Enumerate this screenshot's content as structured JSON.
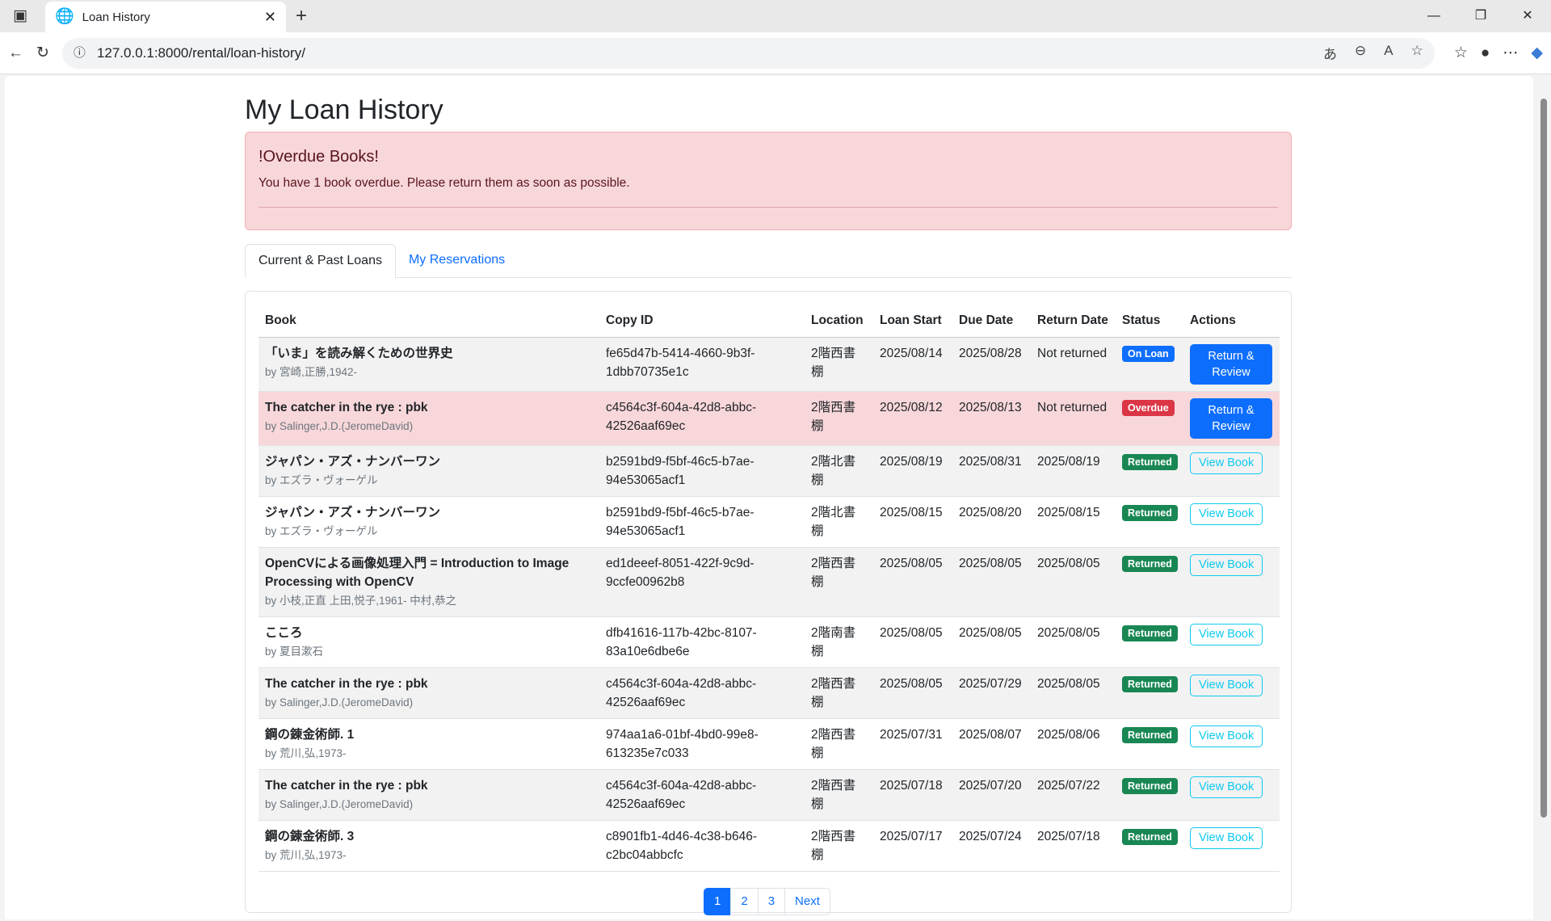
{
  "browser": {
    "tab_title": "Loan History",
    "url": "127.0.0.1:8000/rental/loan-history/"
  },
  "page": {
    "title": "My Loan History"
  },
  "alert": {
    "heading": "!Overdue Books!",
    "message": "You have 1 book overdue. Please return them as soon as possible."
  },
  "tabs": [
    {
      "label": "Current & Past Loans"
    },
    {
      "label": "My Reservations"
    }
  ],
  "table": {
    "headers": [
      "Book",
      "Copy ID",
      "Location",
      "Loan Start",
      "Due Date",
      "Return Date",
      "Status",
      "Actions"
    ],
    "rows": [
      {
        "title": "「いま」を読み解くための世界史",
        "author": "by 宮崎,正勝,1942-",
        "copy_id": "fe65d47b-5414-4660-9b3f-1dbb70735e1c",
        "location": "2階西書棚",
        "loan_start": "2025/08/14",
        "due": "2025/08/28",
        "returned": "Not returned",
        "status": "On Loan",
        "action": "Return & Review"
      },
      {
        "title": "The catcher in the rye : pbk",
        "author": "by Salinger,J.D.(JeromeDavid)",
        "copy_id": "c4564c3f-604a-42d8-abbc-42526aaf69ec",
        "location": "2階西書棚",
        "loan_start": "2025/08/12",
        "due": "2025/08/13",
        "returned": "Not returned",
        "status": "Overdue",
        "action": "Return & Review"
      },
      {
        "title": "ジャパン・アズ・ナンバーワン",
        "author": "by エズラ・ヴォーゲル",
        "copy_id": "b2591bd9-f5bf-46c5-b7ae-94e53065acf1",
        "location": "2階北書棚",
        "loan_start": "2025/08/19",
        "due": "2025/08/31",
        "returned": "2025/08/19",
        "status": "Returned",
        "action": "View Book"
      },
      {
        "title": "ジャパン・アズ・ナンバーワン",
        "author": "by エズラ・ヴォーゲル",
        "copy_id": "b2591bd9-f5bf-46c5-b7ae-94e53065acf1",
        "location": "2階北書棚",
        "loan_start": "2025/08/15",
        "due": "2025/08/20",
        "returned": "2025/08/15",
        "status": "Returned",
        "action": "View Book"
      },
      {
        "title": "OpenCVによる画像処理入門 = Introduction to Image Processing with OpenCV",
        "author": "by 小枝,正直 上田,悦子,1961- 中村,恭之",
        "copy_id": "ed1deeef-8051-422f-9c9d-9ccfe00962b8",
        "location": "2階西書棚",
        "loan_start": "2025/08/05",
        "due": "2025/08/05",
        "returned": "2025/08/05",
        "status": "Returned",
        "action": "View Book"
      },
      {
        "title": "こころ",
        "author": "by 夏目漱石",
        "copy_id": "dfb41616-117b-42bc-8107-83a10e6dbe6e",
        "location": "2階南書棚",
        "loan_start": "2025/08/05",
        "due": "2025/08/05",
        "returned": "2025/08/05",
        "status": "Returned",
        "action": "View Book"
      },
      {
        "title": "The catcher in the rye : pbk",
        "author": "by Salinger,J.D.(JeromeDavid)",
        "copy_id": "c4564c3f-604a-42d8-abbc-42526aaf69ec",
        "location": "2階西書棚",
        "loan_start": "2025/08/05",
        "due": "2025/07/29",
        "returned": "2025/08/05",
        "status": "Returned",
        "action": "View Book"
      },
      {
        "title": "鋼の錬金術師. 1",
        "author": "by 荒川,弘,1973-",
        "copy_id": "974aa1a6-01bf-4bd0-99e8-613235e7c033",
        "location": "2階西書棚",
        "loan_start": "2025/07/31",
        "due": "2025/08/07",
        "returned": "2025/08/06",
        "status": "Returned",
        "action": "View Book"
      },
      {
        "title": "The catcher in the rye : pbk",
        "author": "by Salinger,J.D.(JeromeDavid)",
        "copy_id": "c4564c3f-604a-42d8-abbc-42526aaf69ec",
        "location": "2階西書棚",
        "loan_start": "2025/07/18",
        "due": "2025/07/20",
        "returned": "2025/07/22",
        "status": "Returned",
        "action": "View Book"
      },
      {
        "title": "鋼の錬金術師. 3",
        "author": "by 荒川,弘,1973-",
        "copy_id": "c8901fb1-4d46-4c38-b646-c2bc04abbcfc",
        "location": "2階西書棚",
        "loan_start": "2025/07/17",
        "due": "2025/07/24",
        "returned": "2025/07/18",
        "status": "Returned",
        "action": "View Book"
      }
    ]
  },
  "status_colors": {
    "On Loan": "#0d6efd",
    "Overdue": "#dc3545",
    "Returned": "#198754"
  },
  "pagination": [
    "1",
    "2",
    "3",
    "Next"
  ]
}
